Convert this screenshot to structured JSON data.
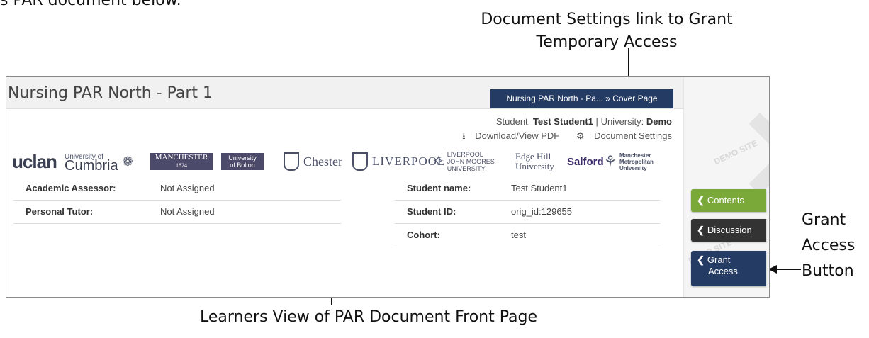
{
  "intro_cut_text": "s PAR document below.",
  "callouts": {
    "document_settings_line1": "Document Settings link to Grant",
    "document_settings_line2": "Temporary Access",
    "grant_access_line1": "Grant",
    "grant_access_line2": "Access",
    "grant_access_line3": "Button",
    "learners_view": "Learners View of PAR Document Front Page"
  },
  "document": {
    "title": "Nursing PAR North - Part 1",
    "breadcrumb": "Nursing PAR North - Pa... » Cover Page",
    "student_label": "Student:",
    "student_value": "Test Student1",
    "separator": "|",
    "university_label": "University:",
    "university_value": "Demo",
    "download_label": "Download/View PDF",
    "settings_label": "Document Settings"
  },
  "logos": {
    "uclan": "uclan",
    "cumbria_small": "University of",
    "cumbria_big": "Cumbria",
    "manchester": "MANCHESTER",
    "manchester_year": "1824",
    "bolton_1": "University",
    "bolton_2": "of Bolton",
    "chester": "Chester",
    "liverpool": "LIVERPOOL",
    "ljmu_1": "LIVERPOOL",
    "ljmu_2": "JOHN MOORES",
    "ljmu_3": "UNIVERSITY",
    "edgehill_1": "Edge Hill",
    "edgehill_2": "University",
    "salford": "Salford",
    "mmu_1": "Manchester",
    "mmu_2": "Metropolitan",
    "mmu_3": "University"
  },
  "left_table": [
    {
      "label": "Academic Assessor:",
      "value": "Not Assigned"
    },
    {
      "label": "Personal Tutor:",
      "value": "Not Assigned"
    }
  ],
  "right_table": [
    {
      "label": "Student name:",
      "value": "Test Student1"
    },
    {
      "label": "Student ID:",
      "value": "orig_id:129655"
    },
    {
      "label": "Cohort:",
      "value": "test"
    }
  ],
  "sidebar": {
    "watermark": "DEMO SITE",
    "contents": "Contents",
    "discussion": "Discussion",
    "grant_1": "Grant",
    "grant_2": "Access"
  },
  "colors": {
    "breadcrumb_bg": "#243b64",
    "contents_btn": "#7aa93a",
    "discussion_btn": "#333333",
    "grant_btn": "#243b64"
  }
}
